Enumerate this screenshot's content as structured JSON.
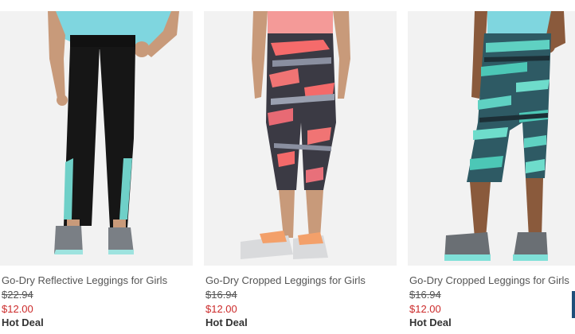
{
  "products": [
    {
      "title": "Go-Dry Reflective Leggings for Girls",
      "original_price": "$22.94",
      "sale_price": "$12.00",
      "badge": "Hot Deal",
      "image_icon": "leggings-black-teal-photo"
    },
    {
      "title": "Go-Dry Cropped Leggings for Girls",
      "original_price": "$16.94",
      "sale_price": "$12.00",
      "badge": "Hot Deal",
      "image_icon": "leggings-coral-print-photo"
    },
    {
      "title": "Go-Dry Cropped Leggings for Girls",
      "original_price": "$16.94",
      "sale_price": "$12.00",
      "badge": "Hot Deal",
      "image_icon": "leggings-teal-print-photo"
    }
  ],
  "colors": {
    "sale_price": "#cc2a2a",
    "text": "#555555",
    "photo_bg": "#f2f2f2"
  }
}
